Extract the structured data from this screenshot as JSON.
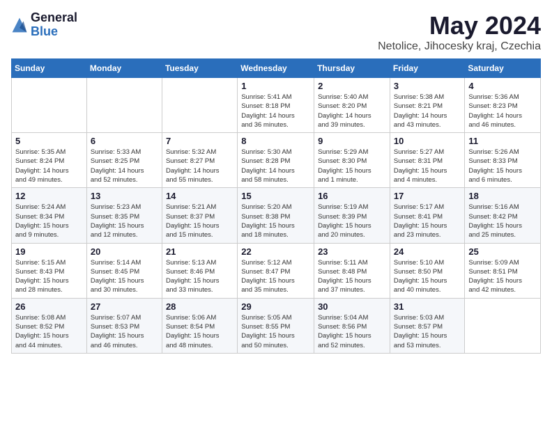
{
  "header": {
    "logo": {
      "general": "General",
      "blue": "Blue"
    },
    "title": "May 2024",
    "location": "Netolice, Jihocesky kraj, Czechia"
  },
  "days_of_week": [
    "Sunday",
    "Monday",
    "Tuesday",
    "Wednesday",
    "Thursday",
    "Friday",
    "Saturday"
  ],
  "weeks": [
    [
      {
        "day": "",
        "info": ""
      },
      {
        "day": "",
        "info": ""
      },
      {
        "day": "",
        "info": ""
      },
      {
        "day": "1",
        "info": "Sunrise: 5:41 AM\nSunset: 8:18 PM\nDaylight: 14 hours\nand 36 minutes."
      },
      {
        "day": "2",
        "info": "Sunrise: 5:40 AM\nSunset: 8:20 PM\nDaylight: 14 hours\nand 39 minutes."
      },
      {
        "day": "3",
        "info": "Sunrise: 5:38 AM\nSunset: 8:21 PM\nDaylight: 14 hours\nand 43 minutes."
      },
      {
        "day": "4",
        "info": "Sunrise: 5:36 AM\nSunset: 8:23 PM\nDaylight: 14 hours\nand 46 minutes."
      }
    ],
    [
      {
        "day": "5",
        "info": "Sunrise: 5:35 AM\nSunset: 8:24 PM\nDaylight: 14 hours\nand 49 minutes."
      },
      {
        "day": "6",
        "info": "Sunrise: 5:33 AM\nSunset: 8:25 PM\nDaylight: 14 hours\nand 52 minutes."
      },
      {
        "day": "7",
        "info": "Sunrise: 5:32 AM\nSunset: 8:27 PM\nDaylight: 14 hours\nand 55 minutes."
      },
      {
        "day": "8",
        "info": "Sunrise: 5:30 AM\nSunset: 8:28 PM\nDaylight: 14 hours\nand 58 minutes."
      },
      {
        "day": "9",
        "info": "Sunrise: 5:29 AM\nSunset: 8:30 PM\nDaylight: 15 hours\nand 1 minute."
      },
      {
        "day": "10",
        "info": "Sunrise: 5:27 AM\nSunset: 8:31 PM\nDaylight: 15 hours\nand 4 minutes."
      },
      {
        "day": "11",
        "info": "Sunrise: 5:26 AM\nSunset: 8:33 PM\nDaylight: 15 hours\nand 6 minutes."
      }
    ],
    [
      {
        "day": "12",
        "info": "Sunrise: 5:24 AM\nSunset: 8:34 PM\nDaylight: 15 hours\nand 9 minutes."
      },
      {
        "day": "13",
        "info": "Sunrise: 5:23 AM\nSunset: 8:35 PM\nDaylight: 15 hours\nand 12 minutes."
      },
      {
        "day": "14",
        "info": "Sunrise: 5:21 AM\nSunset: 8:37 PM\nDaylight: 15 hours\nand 15 minutes."
      },
      {
        "day": "15",
        "info": "Sunrise: 5:20 AM\nSunset: 8:38 PM\nDaylight: 15 hours\nand 18 minutes."
      },
      {
        "day": "16",
        "info": "Sunrise: 5:19 AM\nSunset: 8:39 PM\nDaylight: 15 hours\nand 20 minutes."
      },
      {
        "day": "17",
        "info": "Sunrise: 5:17 AM\nSunset: 8:41 PM\nDaylight: 15 hours\nand 23 minutes."
      },
      {
        "day": "18",
        "info": "Sunrise: 5:16 AM\nSunset: 8:42 PM\nDaylight: 15 hours\nand 25 minutes."
      }
    ],
    [
      {
        "day": "19",
        "info": "Sunrise: 5:15 AM\nSunset: 8:43 PM\nDaylight: 15 hours\nand 28 minutes."
      },
      {
        "day": "20",
        "info": "Sunrise: 5:14 AM\nSunset: 8:45 PM\nDaylight: 15 hours\nand 30 minutes."
      },
      {
        "day": "21",
        "info": "Sunrise: 5:13 AM\nSunset: 8:46 PM\nDaylight: 15 hours\nand 33 minutes."
      },
      {
        "day": "22",
        "info": "Sunrise: 5:12 AM\nSunset: 8:47 PM\nDaylight: 15 hours\nand 35 minutes."
      },
      {
        "day": "23",
        "info": "Sunrise: 5:11 AM\nSunset: 8:48 PM\nDaylight: 15 hours\nand 37 minutes."
      },
      {
        "day": "24",
        "info": "Sunrise: 5:10 AM\nSunset: 8:50 PM\nDaylight: 15 hours\nand 40 minutes."
      },
      {
        "day": "25",
        "info": "Sunrise: 5:09 AM\nSunset: 8:51 PM\nDaylight: 15 hours\nand 42 minutes."
      }
    ],
    [
      {
        "day": "26",
        "info": "Sunrise: 5:08 AM\nSunset: 8:52 PM\nDaylight: 15 hours\nand 44 minutes."
      },
      {
        "day": "27",
        "info": "Sunrise: 5:07 AM\nSunset: 8:53 PM\nDaylight: 15 hours\nand 46 minutes."
      },
      {
        "day": "28",
        "info": "Sunrise: 5:06 AM\nSunset: 8:54 PM\nDaylight: 15 hours\nand 48 minutes."
      },
      {
        "day": "29",
        "info": "Sunrise: 5:05 AM\nSunset: 8:55 PM\nDaylight: 15 hours\nand 50 minutes."
      },
      {
        "day": "30",
        "info": "Sunrise: 5:04 AM\nSunset: 8:56 PM\nDaylight: 15 hours\nand 52 minutes."
      },
      {
        "day": "31",
        "info": "Sunrise: 5:03 AM\nSunset: 8:57 PM\nDaylight: 15 hours\nand 53 minutes."
      },
      {
        "day": "",
        "info": ""
      }
    ]
  ]
}
